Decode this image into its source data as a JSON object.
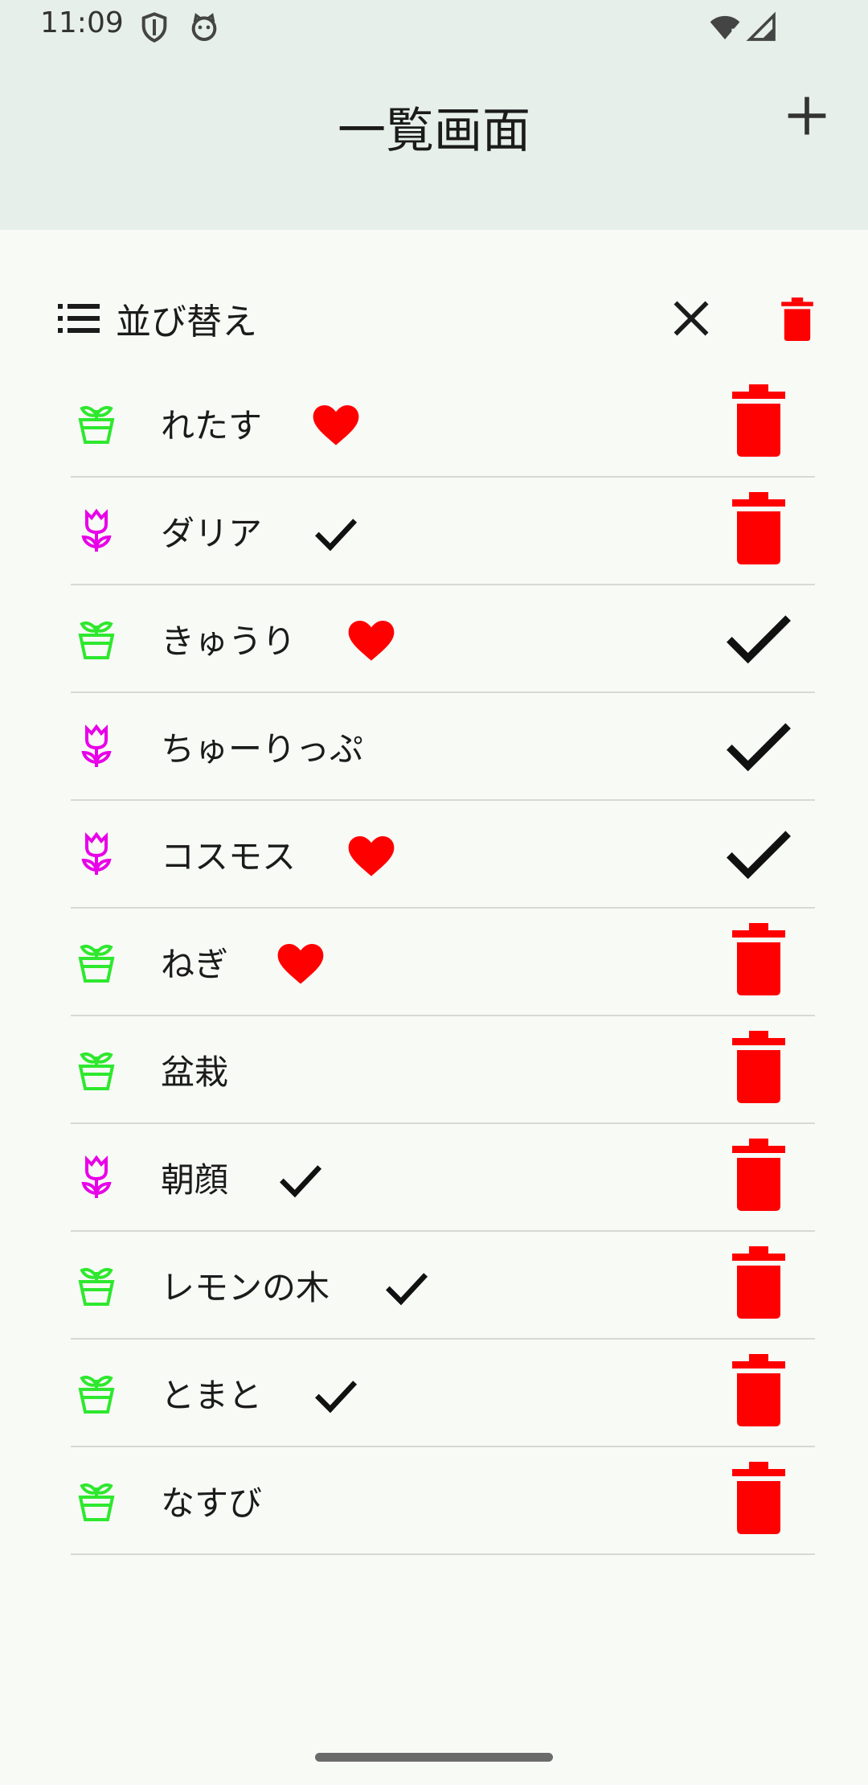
{
  "status_bar": {
    "time": "11:09",
    "icons": [
      "shield-icon",
      "cat-face-icon",
      "wifi-icon",
      "signal-icon"
    ]
  },
  "app_bar": {
    "title": "一覧画面",
    "add_icon": "plus-icon"
  },
  "toolbar": {
    "sort_label": "並び替え",
    "sort_icon": "list-icon",
    "close_icon": "close-icon",
    "delete_icon": "trash-icon"
  },
  "colors": {
    "sprout": "#2ee82e",
    "tulip": "#e800e8",
    "accent_red": "#ff0000",
    "bar_bg": "#e6efe9"
  },
  "plants": [
    {
      "name": "れたす",
      "type": "sprout",
      "mark": "heart",
      "action": "delete"
    },
    {
      "name": "ダリア",
      "type": "tulip",
      "mark": "check",
      "action": "delete"
    },
    {
      "name": "きゅうり",
      "type": "sprout",
      "mark": "heart",
      "action": "check"
    },
    {
      "name": "ちゅーりっぷ",
      "type": "tulip",
      "mark": "",
      "action": "check"
    },
    {
      "name": "コスモス",
      "type": "tulip",
      "mark": "heart",
      "action": "check"
    },
    {
      "name": "ねぎ",
      "type": "sprout",
      "mark": "heart",
      "action": "delete"
    },
    {
      "name": "盆栽",
      "type": "sprout",
      "mark": "",
      "action": "delete"
    },
    {
      "name": "朝顔",
      "type": "tulip",
      "mark": "check",
      "action": "delete"
    },
    {
      "name": "レモンの木",
      "type": "sprout",
      "mark": "check",
      "action": "delete"
    },
    {
      "name": "とまと",
      "type": "sprout",
      "mark": "check",
      "action": "delete"
    },
    {
      "name": "なすび",
      "type": "sprout",
      "mark": "",
      "action": "delete"
    }
  ]
}
